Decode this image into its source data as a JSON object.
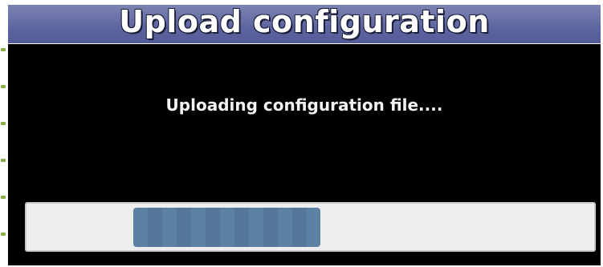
{
  "dialog": {
    "title": "Upload configuration",
    "message": "Uploading configuration file....",
    "progress": {
      "start_fraction": 0.19,
      "end_fraction": 0.52,
      "indeterminate": true
    }
  },
  "colors": {
    "title_bar": "#5d65a1",
    "background": "#000000",
    "track": "#eeeeee",
    "fill": "#5d81a3"
  }
}
